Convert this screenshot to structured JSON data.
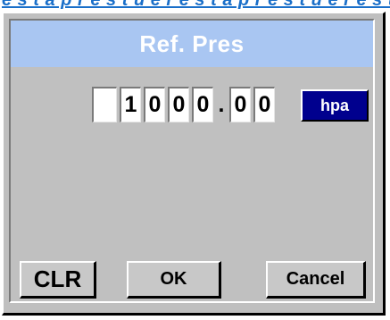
{
  "header": {
    "banner_text": "e s t a p r e s t u e r e s t a p r e s t u e r e s t u e"
  },
  "dialog": {
    "title": "Ref. Pres",
    "value": {
      "digits": [
        "",
        "1",
        "0",
        "0",
        "0",
        ".",
        "0",
        "0"
      ],
      "unit": "hpa"
    },
    "buttons": {
      "clear": "CLR",
      "ok": "OK",
      "cancel": "Cancel"
    }
  }
}
